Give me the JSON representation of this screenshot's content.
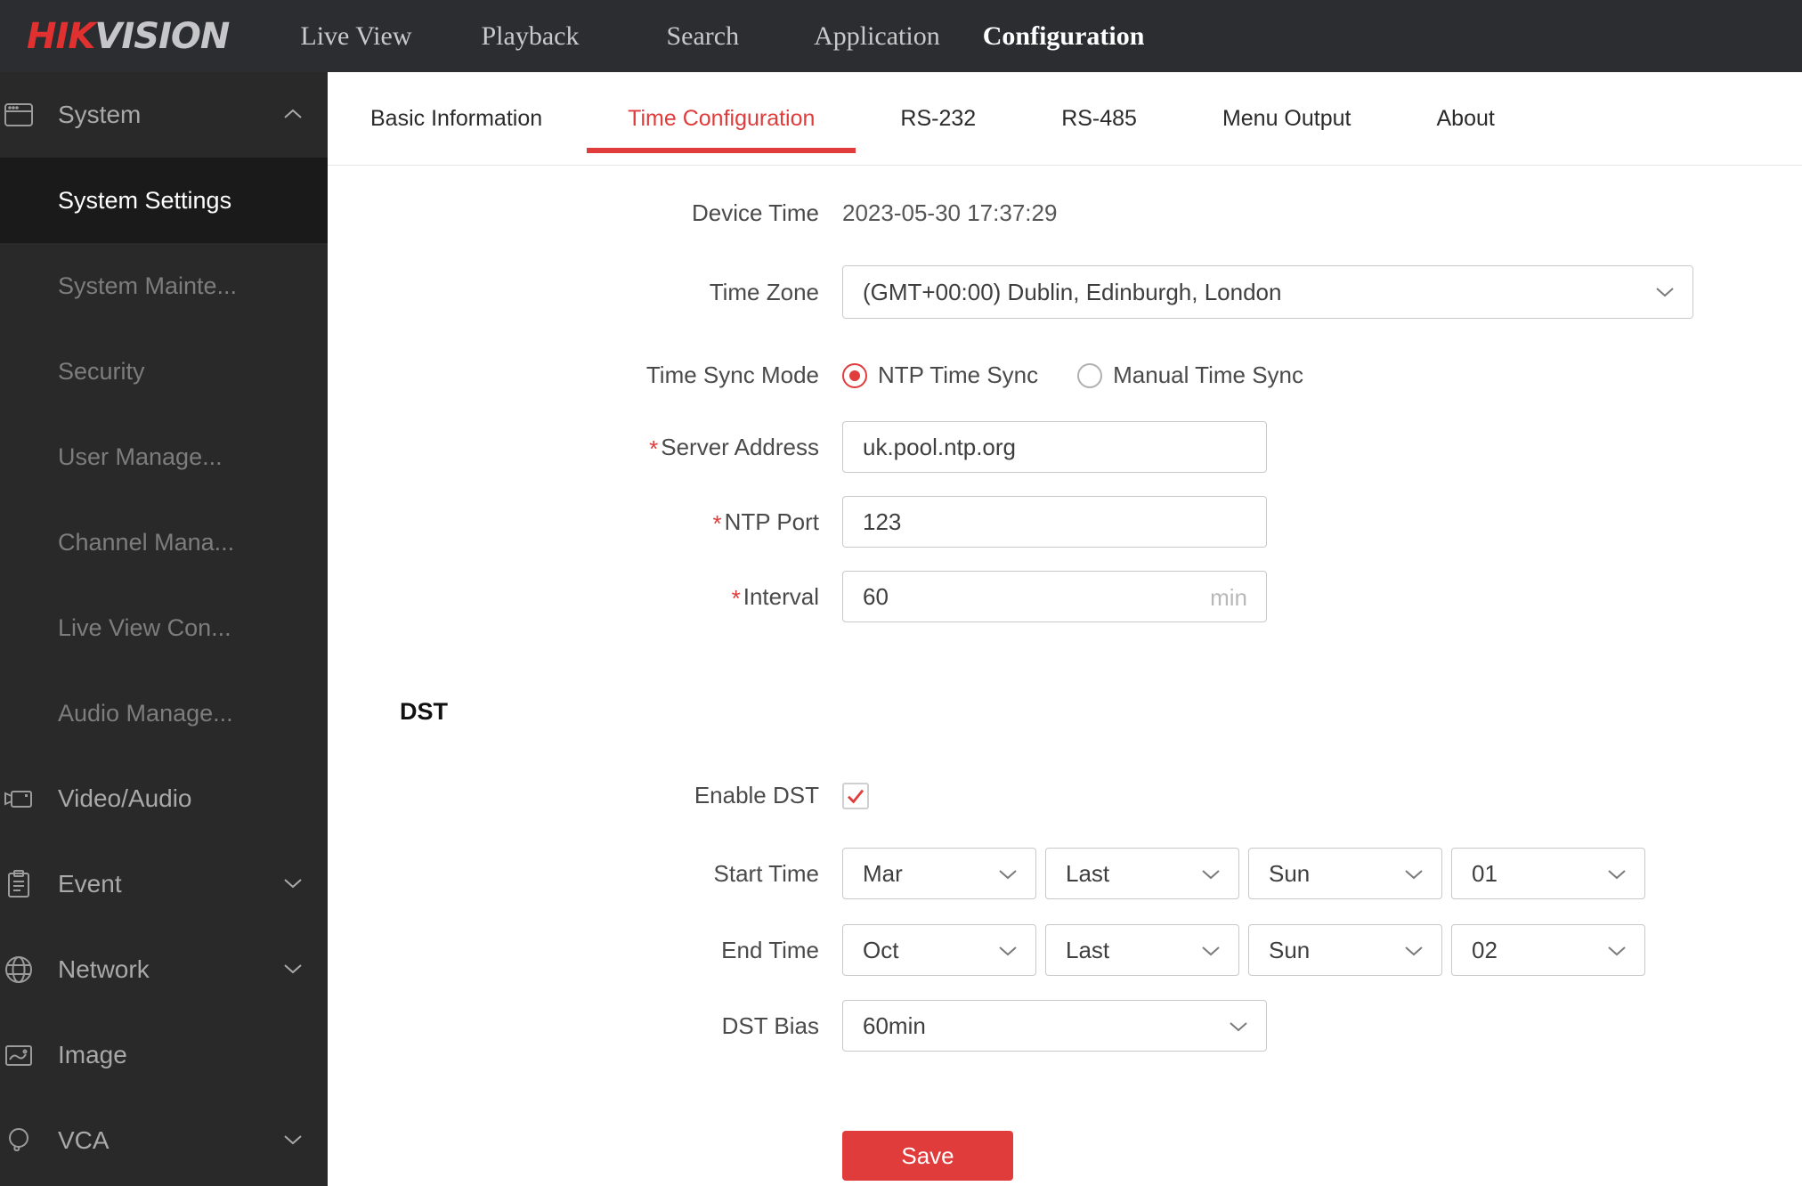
{
  "nav": {
    "logo": {
      "hik": "HIK",
      "vision": "VISION"
    },
    "items": [
      {
        "label": "Live View"
      },
      {
        "label": "Playback"
      },
      {
        "label": "Search"
      },
      {
        "label": "Application"
      },
      {
        "label": "Configuration",
        "active": true
      }
    ]
  },
  "sidebar": {
    "items": [
      {
        "label": "System",
        "type": "group",
        "icon": "system-icon",
        "caret": "up"
      },
      {
        "label": "System Settings",
        "type": "sub",
        "active": true
      },
      {
        "label": "System Mainte...",
        "type": "sub"
      },
      {
        "label": "Security",
        "type": "sub"
      },
      {
        "label": "User Manage...",
        "type": "sub"
      },
      {
        "label": "Channel Mana...",
        "type": "sub"
      },
      {
        "label": "Live View Con...",
        "type": "sub"
      },
      {
        "label": "Audio Manage...",
        "type": "sub"
      },
      {
        "label": "Video/Audio",
        "type": "group",
        "icon": "video-audio-icon"
      },
      {
        "label": "Event",
        "type": "group",
        "icon": "event-icon",
        "caret": "down"
      },
      {
        "label": "Network",
        "type": "group",
        "icon": "network-icon",
        "caret": "down"
      },
      {
        "label": "Image",
        "type": "group",
        "icon": "image-icon"
      },
      {
        "label": "VCA",
        "type": "group",
        "icon": "vca-icon",
        "caret": "down"
      }
    ]
  },
  "tabs": {
    "items": [
      {
        "label": "Basic Information"
      },
      {
        "label": "Time Configuration",
        "active": true
      },
      {
        "label": "RS-232"
      },
      {
        "label": "RS-485"
      },
      {
        "label": "Menu Output"
      },
      {
        "label": "About"
      }
    ]
  },
  "form": {
    "device_time": {
      "label": "Device Time",
      "value": "2023-05-30 17:37:29"
    },
    "time_zone": {
      "label": "Time Zone",
      "value": "(GMT+00:00) Dublin, Edinburgh, London"
    },
    "time_sync_mode": {
      "label": "Time Sync Mode",
      "options": [
        {
          "label": "NTP Time Sync",
          "selected": true
        },
        {
          "label": "Manual Time Sync",
          "selected": false
        }
      ]
    },
    "server_address": {
      "label": "Server Address",
      "required": "*",
      "value": "uk.pool.ntp.org"
    },
    "ntp_port": {
      "label": "NTP Port",
      "required": "*",
      "value": "123"
    },
    "interval": {
      "label": "Interval",
      "required": "*",
      "value": "60",
      "unit": "min"
    },
    "dst": {
      "heading": "DST",
      "enable": {
        "label": "Enable DST",
        "checked": true
      },
      "start_time": {
        "label": "Start Time",
        "month": "Mar",
        "week": "Last",
        "day": "Sun",
        "hour": "01"
      },
      "end_time": {
        "label": "End Time",
        "month": "Oct",
        "week": "Last",
        "day": "Sun",
        "hour": "02"
      },
      "dst_bias": {
        "label": "DST Bias",
        "value": "60min"
      }
    },
    "save_label": "Save"
  },
  "colors": {
    "accent_red": "#e03c3c",
    "topnav_bg": "#2b2d31",
    "sidebar_bg": "#292929",
    "sidebar_active_bg": "#1a1a1a",
    "input_border": "#c9c9c9"
  }
}
